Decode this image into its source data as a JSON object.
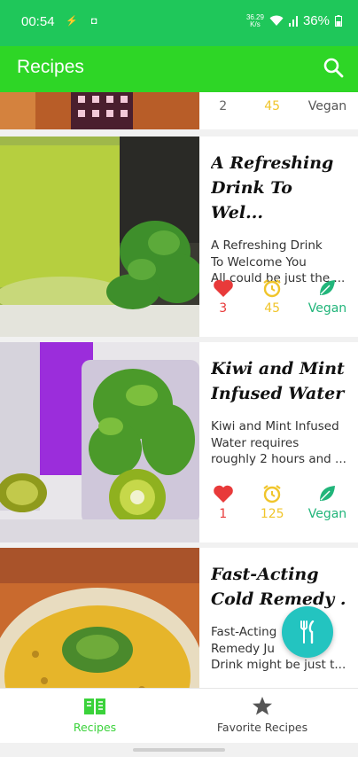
{
  "status_bar": {
    "time": "00:54",
    "net_speed_value": "36.29",
    "net_speed_unit": "K/s",
    "battery": "36%"
  },
  "app_bar": {
    "title": "Recipes",
    "search_icon": "search-icon"
  },
  "recipes": [
    {
      "title": "",
      "description": "",
      "likes": "2",
      "time": "45",
      "tag": "Vegan"
    },
    {
      "title": "A Refreshing Drink To Wel...",
      "description_lines": [
        "A Refreshing Drink",
        "To Welcome You",
        "All could be just the ..."
      ],
      "likes": "3",
      "time": "45",
      "tag": "Vegan"
    },
    {
      "title_lines": [
        "Kiwi and Mint",
        "Infused Water"
      ],
      "description_lines": [
        "Kiwi and Mint Infused",
        "Water requires",
        "roughly 2 hours and ..."
      ],
      "likes": "1",
      "time": "125",
      "tag": "Vegan"
    },
    {
      "title_lines": [
        "Fast-Acting",
        "Cold Remedy ..."
      ],
      "description_lines": [
        "Fast-Acting",
        "Remedy Ju",
        "Drink might be just t..."
      ]
    }
  ],
  "bottom_nav": {
    "recipes_label": "Recipes",
    "favorites_label": "Favorite Recipes"
  },
  "colors": {
    "status_green": "#1fc75a",
    "appbar_green": "#2ed626",
    "like_red": "#e83a3a",
    "time_yellow": "#f0c52b",
    "vegan_green": "#21b57a",
    "fab_teal": "#23c4c0"
  }
}
